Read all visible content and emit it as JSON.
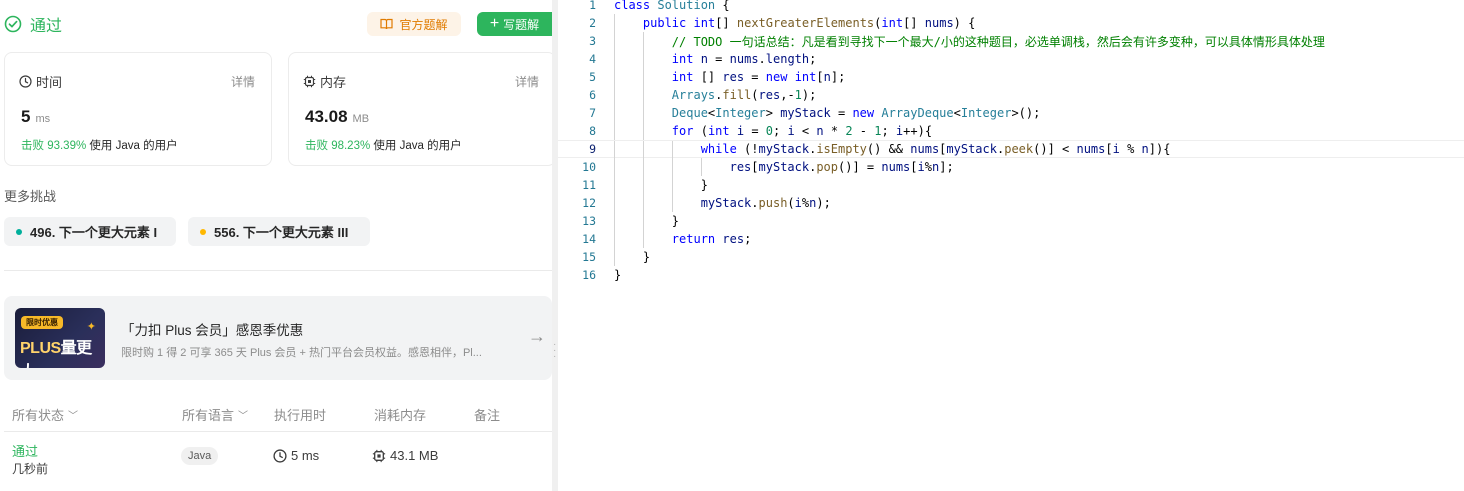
{
  "status": {
    "text": "通过",
    "color": "#2db55d"
  },
  "toolbar": {
    "official_label": "官方题解",
    "write_label": "写题解"
  },
  "runtime": {
    "title": "时间",
    "detail": "详情",
    "value": "5",
    "unit": "ms",
    "beat_pct": "击败 93.39%",
    "beat_text": "使用 Java 的用户"
  },
  "memory": {
    "title": "内存",
    "detail": "详情",
    "value": "43.08",
    "unit": "MB",
    "beat_pct": "击败 98.23%",
    "beat_text": "使用 Java 的用户"
  },
  "more": {
    "title": "更多挑战",
    "items": [
      {
        "label": "496. 下一个更大元素 I",
        "dot": "#00af9b"
      },
      {
        "label": "556. 下一个更大元素 III",
        "dot": "#ffb800"
      }
    ]
  },
  "promo": {
    "tag": "限时优惠",
    "image_text_1": "PLUS",
    "image_text_2": "量更大",
    "title": "「力扣 Plus 会员」感恩季优惠",
    "subtitle": "限时购 1 得 2 可享 365 天 Plus 会员 + 热门平台会员权益。感恩相伴，Pl..."
  },
  "submissions": {
    "headers": [
      "所有状态",
      "所有语言",
      "执行用时",
      "消耗内存",
      "备注"
    ],
    "rows": [
      {
        "status": "通过",
        "time_ago": "几秒前",
        "language": "Java",
        "runtime": "5 ms",
        "memory": "43.1 MB"
      }
    ]
  },
  "editor": {
    "line_numbers": [
      "1",
      "2",
      "3",
      "4",
      "5",
      "6",
      "7",
      "8",
      "9",
      "10",
      "11",
      "12",
      "13",
      "14",
      "15",
      "16"
    ],
    "current_line": 9
  }
}
